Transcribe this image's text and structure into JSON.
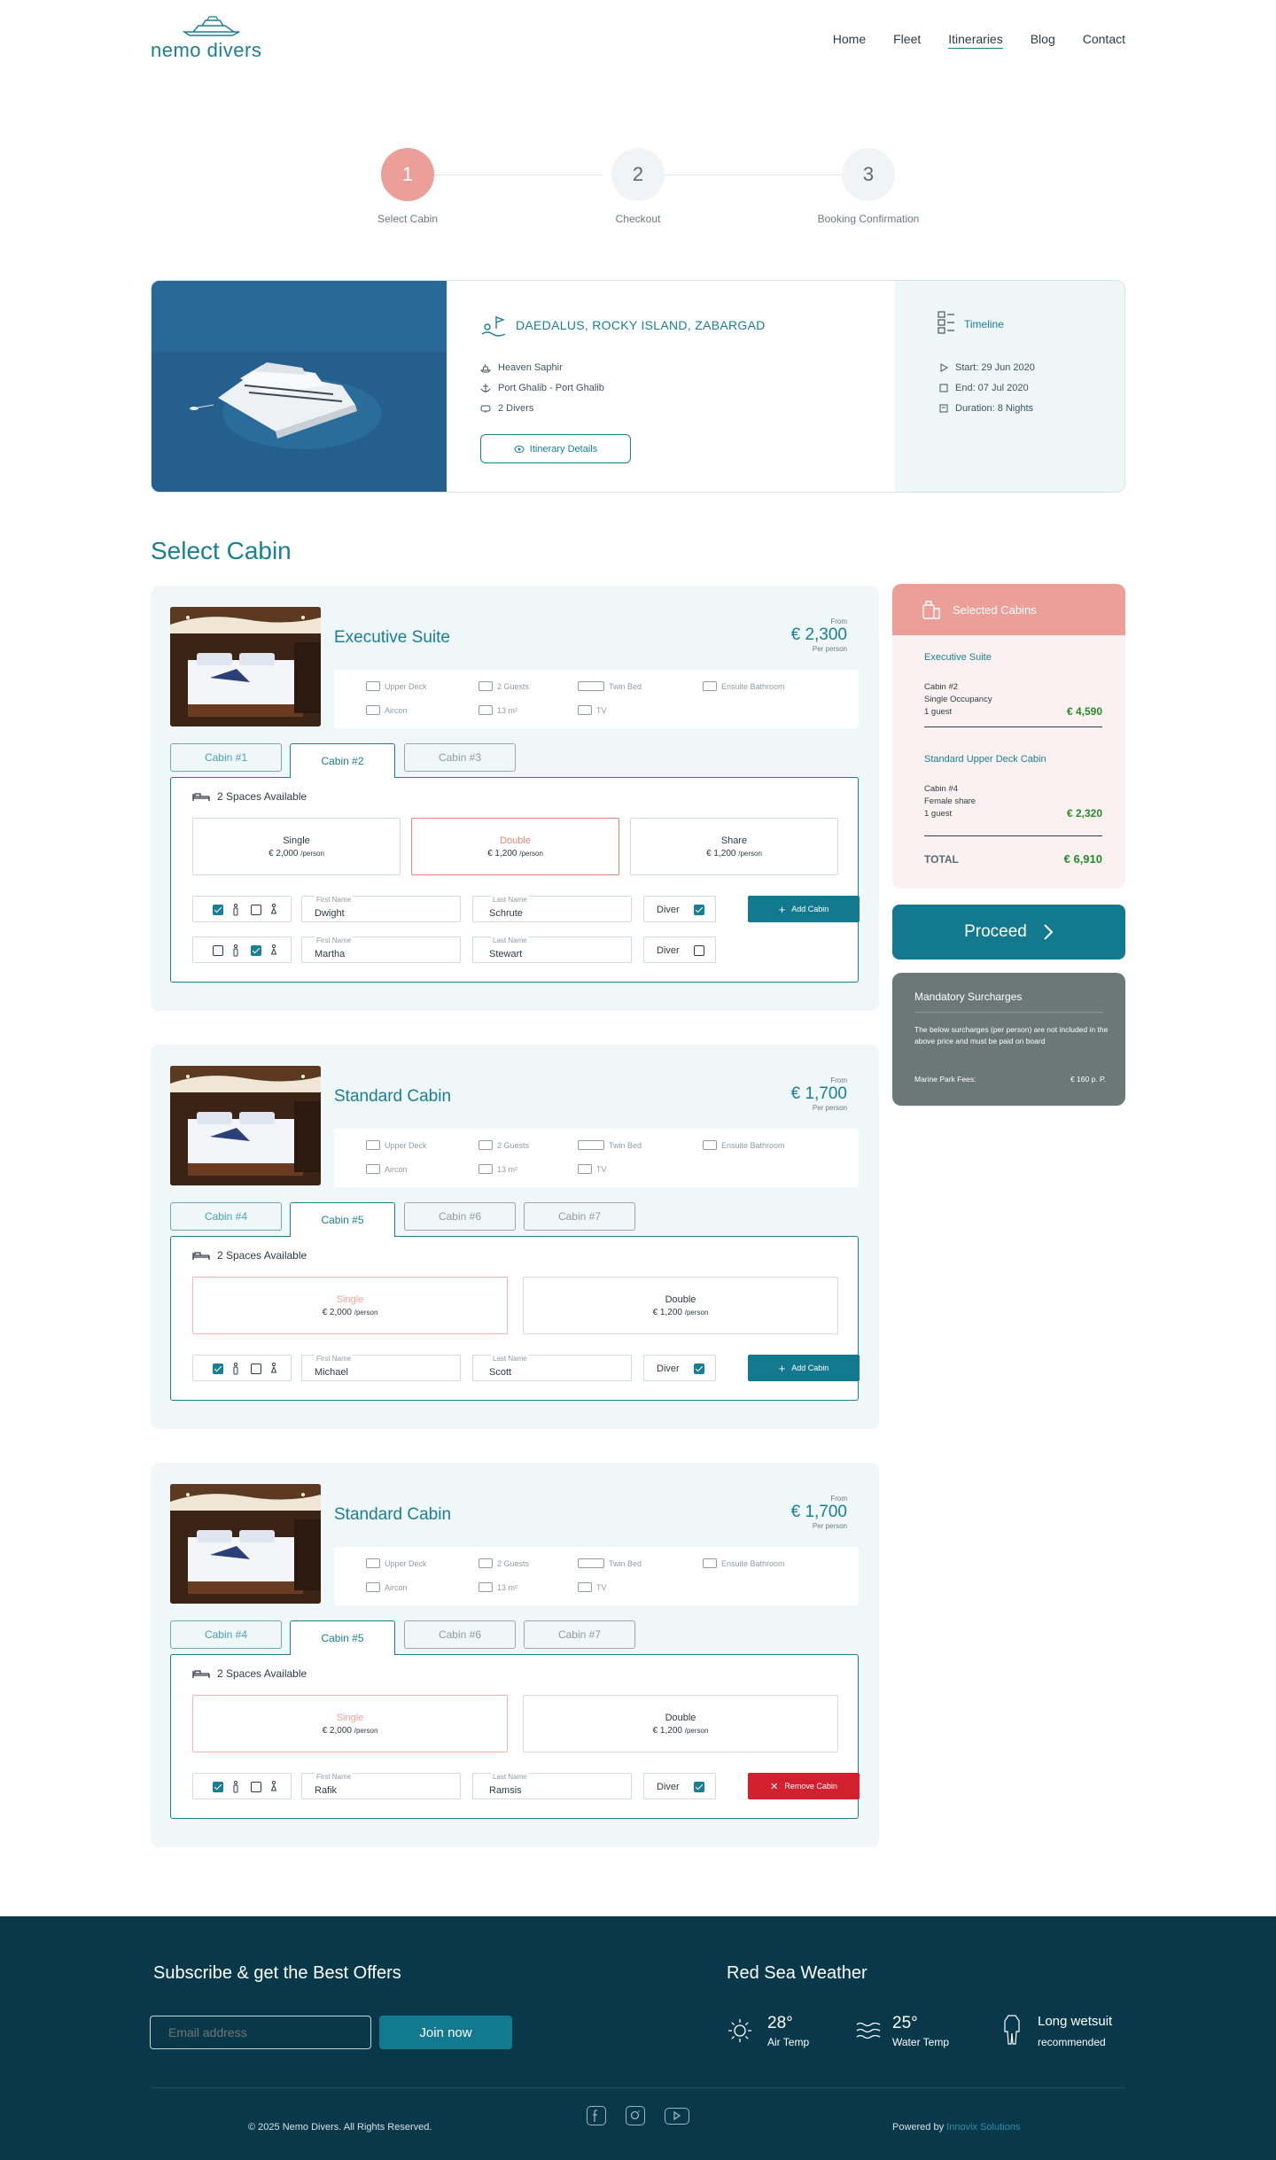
{
  "brand": {
    "name": "nemo divers",
    "accent": "#1a7f95",
    "coral": "#ec9e98"
  },
  "nav": {
    "items": [
      "Home",
      "Fleet",
      "Itineraries",
      "Blog",
      "Contact"
    ],
    "active": "Itineraries"
  },
  "steps": [
    {
      "num": "1",
      "label": "Select Cabin",
      "active": true
    },
    {
      "num": "2",
      "label": "Checkout",
      "active": false
    },
    {
      "num": "3",
      "label": "Booking Confirmation",
      "active": false
    }
  ],
  "trip": {
    "title": "DAEDALUS, ROCKY ISLAND, ZABARGAD",
    "boat": "Heaven Saphir",
    "route": "Port Ghalib - Port Ghalib",
    "divers": "2 Divers",
    "details_button": "Itinerary Details",
    "timeline_title": "Timeline",
    "start": "Start: 29 Jun 2020",
    "end": "End: 07 Jul 2020",
    "duration": "Duration: 8 Nights"
  },
  "section_title": "Select Cabin",
  "amenities": {
    "deck": "Upper Deck",
    "guests": "2 Guests",
    "bed": "Twin Bed",
    "bath": "Ensuite Bathroom",
    "aircon": "Aircon",
    "size": "13 m²",
    "tv": "TV"
  },
  "common": {
    "from": "From",
    "per_person": "Per person",
    "spaces": "2 Spaces Available",
    "first_name": "First Name",
    "last_name": "Last Name",
    "diver": "Diver",
    "add_cabin": "Add Cabin",
    "remove_cabin": "Remove Cabin",
    "per_person_suffix": "/person",
    "single": "Single",
    "double": "Double",
    "share": "Share",
    "single_price": "€ 2,000",
    "double_price": "€ 1,200",
    "share_price": "€ 1,200"
  },
  "cabins": [
    {
      "name": "Executive Suite",
      "price": "€ 2,300",
      "tabs": [
        "Cabin #1",
        "Cabin #2",
        "Cabin #3"
      ],
      "guests": [
        {
          "first": "Dwight",
          "last": "Schrute"
        },
        {
          "first": "Martha",
          "last": "Stewart"
        }
      ]
    },
    {
      "name": "Standard Cabin",
      "price": "€ 1,700",
      "tabs": [
        "Cabin #4",
        "Cabin #5",
        "Cabin #6",
        "Cabin #7"
      ],
      "guests": [
        {
          "first": "Michael",
          "last": "Scott"
        }
      ]
    },
    {
      "name": "Standard Cabin",
      "price": "€ 1,700",
      "tabs": [
        "Cabin #4",
        "Cabin #5",
        "Cabin #6",
        "Cabin #7"
      ],
      "guests": [
        {
          "first": "Rafik",
          "last": "Ramsis"
        }
      ]
    }
  ],
  "selected": {
    "title": "Selected Cabins",
    "group1_title": "Executive Suite",
    "g1_line1": "Cabin #2",
    "g1_line2": "Single Occupancy",
    "g1_line3": "1 guest",
    "g1_price": "€ 4,590",
    "group2_title": "Standard Upper Deck Cabin",
    "g2_line1": "Cabin #4",
    "g2_line2": "Female share",
    "g2_line3": "1 guest",
    "g2_price": "€ 2,320",
    "total_label": "TOTAL",
    "total": "€ 6,910"
  },
  "proceed": "Proceed",
  "surcharges": {
    "title": "Mandatory Surcharges",
    "text": "The below surcharges (per person) are not included in the above price and must be paid on board",
    "fee_label": "Marine Park Fees:",
    "fee_value": "€ 160 p. P."
  },
  "footer": {
    "subscribe_title": "Subscribe & get the Best Offers",
    "email_placeholder": "Email address",
    "join": "Join now",
    "weather_title": "Red Sea Weather",
    "air_temp": "28°",
    "air_label": "Air Temp",
    "water_temp": "25°",
    "water_label": "Water Temp",
    "wetsuit": "Long wetsuit",
    "wetsuit_sub": "recommended",
    "copyright": "© 2025 Nemo Divers. All Rights Reserved.",
    "powered": "Powered by",
    "powered_by": "Innovix Solutions"
  }
}
